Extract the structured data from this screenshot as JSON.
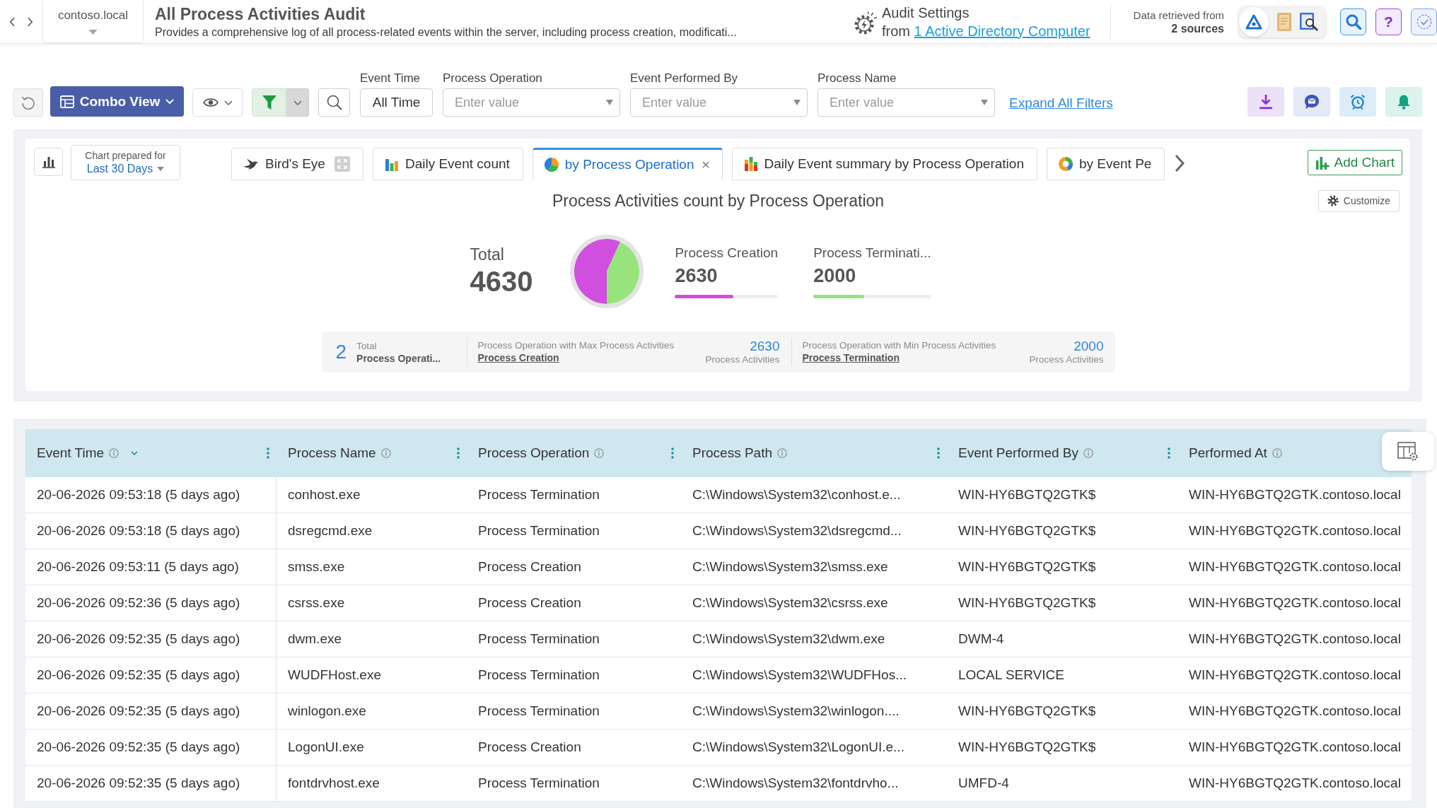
{
  "header": {
    "domain": "contoso.local",
    "title": "All Process Activities Audit",
    "description": "Provides a comprehensive log of all process-related events within the server, including process creation, modificati...",
    "audit_settings": {
      "title": "Audit Settings",
      "prefix": "from",
      "link": "1 Active Directory Computer"
    },
    "data_sources": {
      "caption": "Data retrieved from",
      "count": "2 sources"
    },
    "help_label": "?"
  },
  "toolbar": {
    "view_button": "Combo View",
    "filters": [
      {
        "kind": "button",
        "label": "Event Time",
        "value": "All Time"
      },
      {
        "kind": "select",
        "label": "Process Operation",
        "placeholder": "Enter value"
      },
      {
        "kind": "select",
        "label": "Event Performed By",
        "placeholder": "Enter value"
      },
      {
        "kind": "select",
        "label": "Process Name",
        "placeholder": "Enter value"
      }
    ],
    "expand_link": "Expand All Filters"
  },
  "chart_panel": {
    "prepared_caption": "Chart prepared for",
    "period": "Last 30 Days",
    "tabs": [
      {
        "kind": "overview",
        "label": "Bird's Eye",
        "selected": false
      },
      {
        "kind": "bar",
        "label": "Daily Event count",
        "selected": false
      },
      {
        "kind": "pie",
        "label": "by Process Operation",
        "selected": true
      },
      {
        "kind": "stacked",
        "label": "Daily Event summary by Process Operation",
        "selected": false
      },
      {
        "kind": "donut",
        "label": "by Event Pe",
        "selected": false
      }
    ],
    "add_chart": "Add Chart",
    "title": "Process Activities count by Process Operation",
    "customize": "Customize",
    "total": {
      "label": "Total",
      "value": "4630"
    },
    "chart_data": {
      "type": "pie",
      "values": [
        56.8,
        43.2
      ]
    },
    "legend": [
      {
        "name": "Process Creation",
        "value": "2630",
        "color": "#d04fdf",
        "level": 0.57
      },
      {
        "name": "Process Terminati...",
        "value": "2000",
        "color": "#98e47c",
        "level": 0.43
      }
    ],
    "summary": {
      "count": "2",
      "count_caption": "Total",
      "count_label": "Process Operati...",
      "stats": [
        {
          "caption": "Process Operation with Max Process Activities",
          "link": "Process Creation",
          "value": "2630",
          "unit": "Process Activities"
        },
        {
          "caption": "Process Operation with Min Process Activities",
          "link": "Process Termination",
          "value": "2000",
          "unit": "Process Activities"
        }
      ]
    }
  },
  "table": {
    "columns": [
      {
        "label": "Event Time",
        "sorted": true
      },
      {
        "label": "Process Name",
        "sorted": false
      },
      {
        "label": "Process Operation",
        "sorted": false
      },
      {
        "label": "Process Path",
        "sorted": false
      },
      {
        "label": "Event Performed By",
        "sorted": false
      },
      {
        "label": "Performed At",
        "sorted": false
      }
    ],
    "rows": [
      [
        "20-06-2026 09:53:18 (5 days ago)",
        "conhost.exe",
        "Process Termination",
        "C:\\Windows\\System32\\conhost.e...",
        "WIN-HY6BGTQ2GTK$",
        "WIN-HY6BGTQ2GTK.contoso.local"
      ],
      [
        "20-06-2026 09:53:18 (5 days ago)",
        "dsregcmd.exe",
        "Process Termination",
        "C:\\Windows\\System32\\dsregcmd...",
        "WIN-HY6BGTQ2GTK$",
        "WIN-HY6BGTQ2GTK.contoso.local"
      ],
      [
        "20-06-2026 09:53:11 (5 days ago)",
        "smss.exe",
        "Process Creation",
        "C:\\Windows\\System32\\smss.exe",
        "WIN-HY6BGTQ2GTK$",
        "WIN-HY6BGTQ2GTK.contoso.local"
      ],
      [
        "20-06-2026 09:52:36 (5 days ago)",
        "csrss.exe",
        "Process Creation",
        "C:\\Windows\\System32\\csrss.exe",
        "WIN-HY6BGTQ2GTK$",
        "WIN-HY6BGTQ2GTK.contoso.local"
      ],
      [
        "20-06-2026 09:52:35 (5 days ago)",
        "dwm.exe",
        "Process Termination",
        "C:\\Windows\\System32\\dwm.exe",
        "DWM-4",
        "WIN-HY6BGTQ2GTK.contoso.local"
      ],
      [
        "20-06-2026 09:52:35 (5 days ago)",
        "WUDFHost.exe",
        "Process Termination",
        "C:\\Windows\\System32\\WUDFHos...",
        "LOCAL SERVICE",
        "WIN-HY6BGTQ2GTK.contoso.local"
      ],
      [
        "20-06-2026 09:52:35 (5 days ago)",
        "winlogon.exe",
        "Process Termination",
        "C:\\Windows\\System32\\winlogon....",
        "WIN-HY6BGTQ2GTK$",
        "WIN-HY6BGTQ2GTK.contoso.local"
      ],
      [
        "20-06-2026 09:52:35 (5 days ago)",
        "LogonUI.exe",
        "Process Creation",
        "C:\\Windows\\System32\\LogonUI.e...",
        "WIN-HY6BGTQ2GTK$",
        "WIN-HY6BGTQ2GTK.contoso.local"
      ],
      [
        "20-06-2026 09:52:35 (5 days ago)",
        "fontdrvhost.exe",
        "Process Termination",
        "C:\\Windows\\System32\\fontdrvho...",
        "UMFD-4",
        "WIN-HY6BGTQ2GTK.contoso.local"
      ]
    ]
  }
}
